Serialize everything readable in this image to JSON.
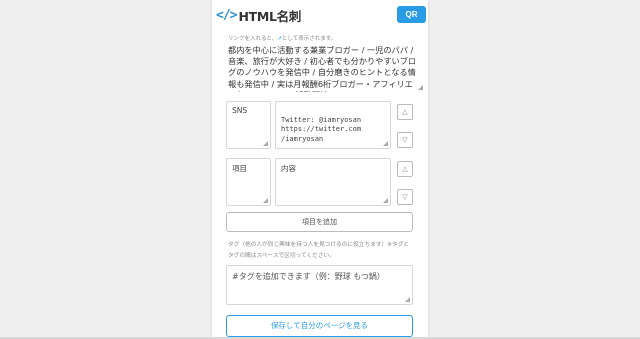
{
  "header": {
    "logo_icon": "</>",
    "logo_text": "HTML名刺",
    "qr_label": "QR"
  },
  "notice": {
    "prefix": "リンクを入れると、",
    "icon": "↗",
    "suffix": "として表示されます。"
  },
  "bio": "都内を中心に活動する兼業ブロガー / 一児のパパ / 音楽、旅行が大好き / 初心者でも分かりやすいブログのノウハウを発信中 / 自分磨きのヒントとなる情報も発信中 / 実は月報酬6桁ブロガー・アフィリエイター / Youtube 活動開始",
  "fields": [
    {
      "key": "SNS",
      "value": "Twitter: @iamryosan\nhttps://twitter.com\n/iamryosan"
    },
    {
      "key": "項目",
      "value": "内容"
    }
  ],
  "arrows": {
    "up": "△",
    "down": "▽"
  },
  "add_item_label": "項目を追加",
  "tag_help": "タグ（他の人が同じ興味を持つ人を見つけるのに役立ちます）※タグとタグの間はスペースで区切ってください。",
  "tag_placeholder": "#タグを追加できます（例：野球 もつ鍋）",
  "save_label": "保存して自分のページを見る"
}
